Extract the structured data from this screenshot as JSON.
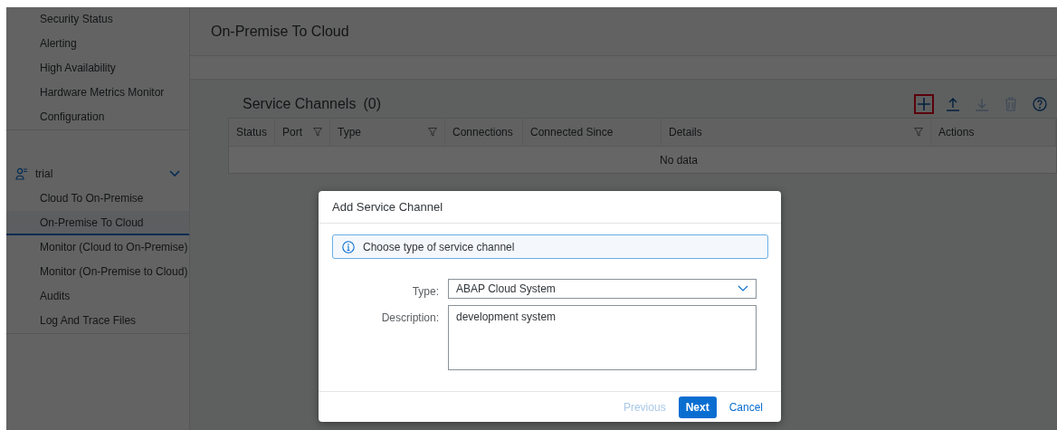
{
  "sidebar": {
    "groups": [
      {
        "items": [
          {
            "label": "Security Status",
            "selected": false
          },
          {
            "label": "Alerting",
            "selected": false
          },
          {
            "label": "High Availability",
            "selected": false
          },
          {
            "label": "Hardware Metrics Monitor",
            "selected": false
          },
          {
            "label": "Configuration",
            "selected": false
          }
        ]
      },
      {
        "header": {
          "label": "trial",
          "expanded": true
        },
        "items": [
          {
            "label": "Cloud To On-Premise",
            "selected": false
          },
          {
            "label": "On-Premise To Cloud",
            "selected": true
          },
          {
            "label": "Monitor (Cloud to On-Premise)",
            "selected": false
          },
          {
            "label": "Monitor (On-Premise to Cloud)",
            "selected": false
          },
          {
            "label": "Audits",
            "selected": false
          },
          {
            "label": "Log And Trace Files",
            "selected": false
          }
        ]
      }
    ]
  },
  "page": {
    "title": "On-Premise To Cloud"
  },
  "table": {
    "title": "Service Channels",
    "count": "(0)",
    "toolbar": [
      {
        "kind": "add",
        "disabled": false,
        "highlighted": true
      },
      {
        "kind": "upload",
        "disabled": false,
        "highlighted": false
      },
      {
        "kind": "download",
        "disabled": true,
        "highlighted": false
      },
      {
        "kind": "delete",
        "disabled": true,
        "highlighted": false
      },
      {
        "kind": "help",
        "disabled": false,
        "highlighted": false
      }
    ],
    "columns": [
      {
        "label": "Status",
        "filter": false
      },
      {
        "label": "Port",
        "filter": true
      },
      {
        "label": "Type",
        "filter": true
      },
      {
        "label": "Connections",
        "filter": false
      },
      {
        "label": "Connected Since",
        "filter": false
      },
      {
        "label": "Details",
        "filter": true
      },
      {
        "label": "Actions",
        "filter": false
      }
    ],
    "empty_text": "No data"
  },
  "dialog": {
    "title": "Add Service Channel",
    "info": "Choose type of service channel",
    "fields": [
      {
        "kind": "select",
        "label": "Type:",
        "value": "ABAP Cloud System"
      },
      {
        "kind": "textarea",
        "label": "Description:",
        "value": "development system"
      }
    ],
    "buttons": [
      {
        "label": "Previous",
        "kind": "text",
        "disabled": true
      },
      {
        "label": "Next",
        "kind": "primary",
        "disabled": false
      },
      {
        "label": "Cancel",
        "kind": "text",
        "disabled": false
      }
    ]
  }
}
